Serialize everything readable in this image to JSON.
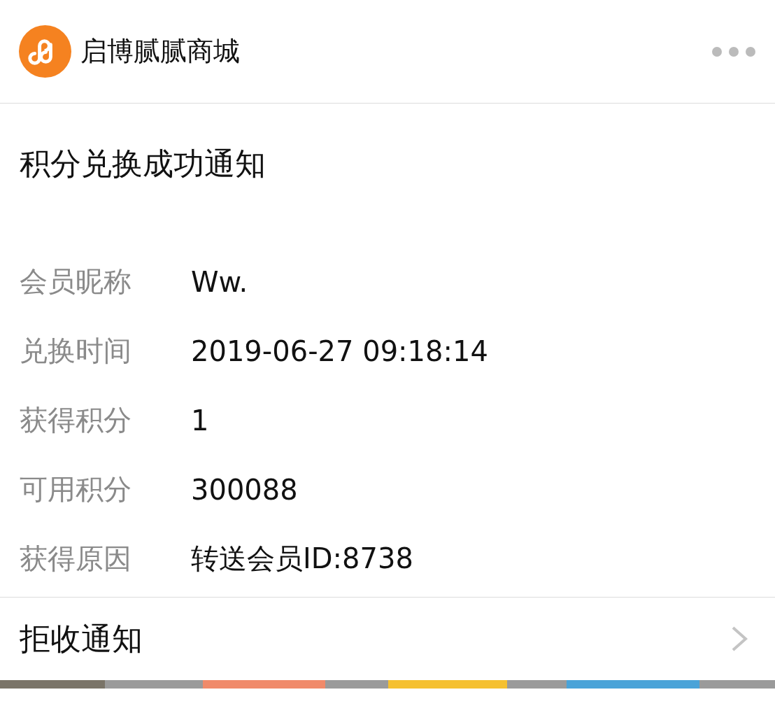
{
  "header": {
    "title": "启博腻腻商城"
  },
  "notice": {
    "title": "积分兑换成功通知",
    "fields": [
      {
        "label": "会员昵称",
        "value": "Ww."
      },
      {
        "label": "兑换时间",
        "value": "2019-06-27 09:18:14"
      },
      {
        "label": "获得积分",
        "value": "1"
      },
      {
        "label": "可用积分",
        "value": "300088"
      },
      {
        "label": "获得原因",
        "value": "转送会员ID:8738"
      }
    ]
  },
  "footer": {
    "label": "拒收通知"
  }
}
